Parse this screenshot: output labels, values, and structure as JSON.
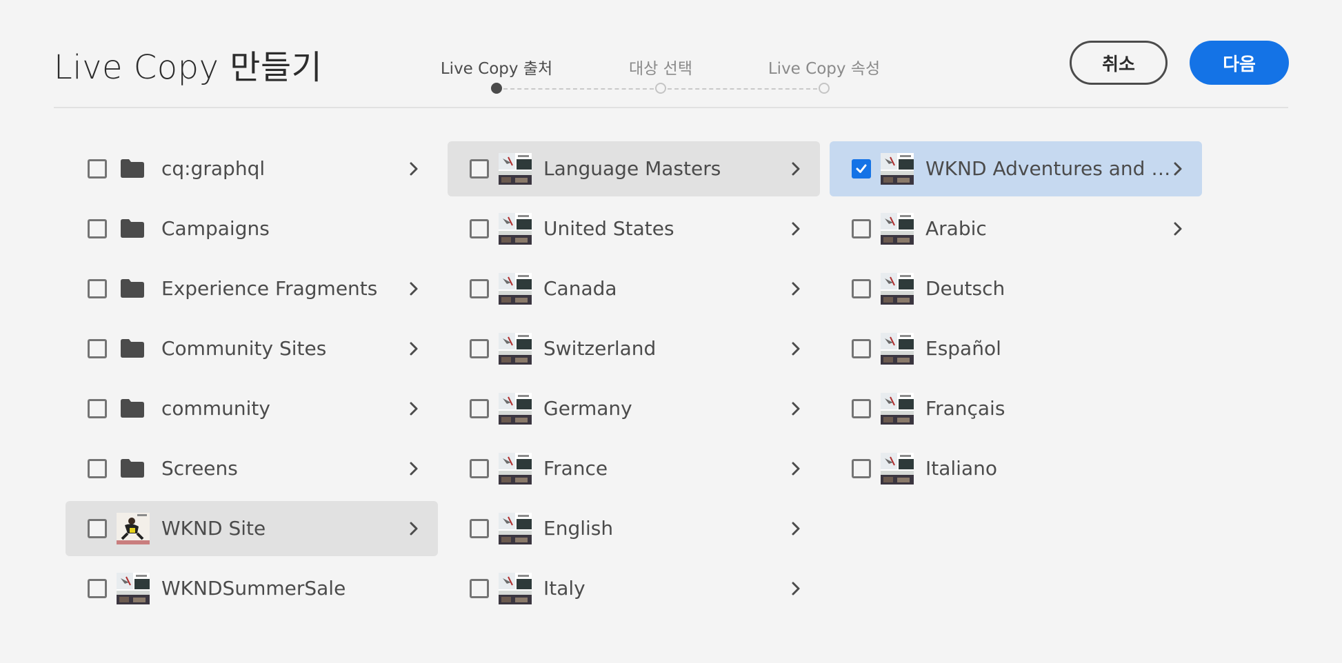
{
  "title": "Live Copy 만들기",
  "wizard": {
    "steps": [
      {
        "label": "Live Copy 출처",
        "active": true
      },
      {
        "label": "대상 선택",
        "active": false
      },
      {
        "label": "Live Copy 속성",
        "active": false
      }
    ]
  },
  "actions": {
    "cancel_label": "취소",
    "next_label": "다음"
  },
  "colors": {
    "accent": "#1473e6",
    "selected_row": "#c6d9f0",
    "hover_row": "#e1e1e1",
    "background": "#f4f4f4"
  },
  "columns": [
    {
      "items": [
        {
          "label": "cq:graphql",
          "icon": "folder-icon",
          "has_children": true,
          "checked": false
        },
        {
          "label": "Campaigns",
          "icon": "folder-icon",
          "has_children": false,
          "checked": false
        },
        {
          "label": "Experience Fragments",
          "icon": "folder-icon",
          "has_children": true,
          "checked": false
        },
        {
          "label": "Community Sites",
          "icon": "folder-icon",
          "has_children": true,
          "checked": false
        },
        {
          "label": "community",
          "icon": "folder-icon",
          "has_children": true,
          "checked": false
        },
        {
          "label": "Screens",
          "icon": "folder-icon",
          "has_children": true,
          "checked": false
        },
        {
          "label": "WKND Site",
          "icon": "skater-thumbnail",
          "has_children": true,
          "checked": false,
          "state": "hover"
        },
        {
          "label": "WKNDSummerSale",
          "icon": "page-thumbnail",
          "has_children": false,
          "checked": false
        }
      ]
    },
    {
      "items": [
        {
          "label": "Language Masters",
          "icon": "page-thumbnail",
          "has_children": true,
          "checked": false,
          "state": "hover"
        },
        {
          "label": "United States",
          "icon": "page-thumbnail",
          "has_children": true,
          "checked": false
        },
        {
          "label": "Canada",
          "icon": "page-thumbnail",
          "has_children": true,
          "checked": false
        },
        {
          "label": "Switzerland",
          "icon": "page-thumbnail",
          "has_children": true,
          "checked": false
        },
        {
          "label": "Germany",
          "icon": "page-thumbnail",
          "has_children": true,
          "checked": false
        },
        {
          "label": "France",
          "icon": "page-thumbnail",
          "has_children": true,
          "checked": false
        },
        {
          "label": "English",
          "icon": "page-thumbnail",
          "has_children": true,
          "checked": false
        },
        {
          "label": "Italy",
          "icon": "page-thumbnail",
          "has_children": true,
          "checked": false
        }
      ]
    },
    {
      "items": [
        {
          "label": "WKND Adventures and Tr...",
          "icon": "page-thumbnail",
          "has_children": true,
          "checked": true,
          "state": "selected"
        },
        {
          "label": "Arabic",
          "icon": "page-thumbnail",
          "has_children": true,
          "checked": false
        },
        {
          "label": "Deutsch",
          "icon": "page-thumbnail",
          "has_children": false,
          "checked": false
        },
        {
          "label": "Español",
          "icon": "page-thumbnail",
          "has_children": false,
          "checked": false
        },
        {
          "label": "Français",
          "icon": "page-thumbnail",
          "has_children": false,
          "checked": false
        },
        {
          "label": "Italiano",
          "icon": "page-thumbnail",
          "has_children": false,
          "checked": false
        }
      ]
    }
  ]
}
